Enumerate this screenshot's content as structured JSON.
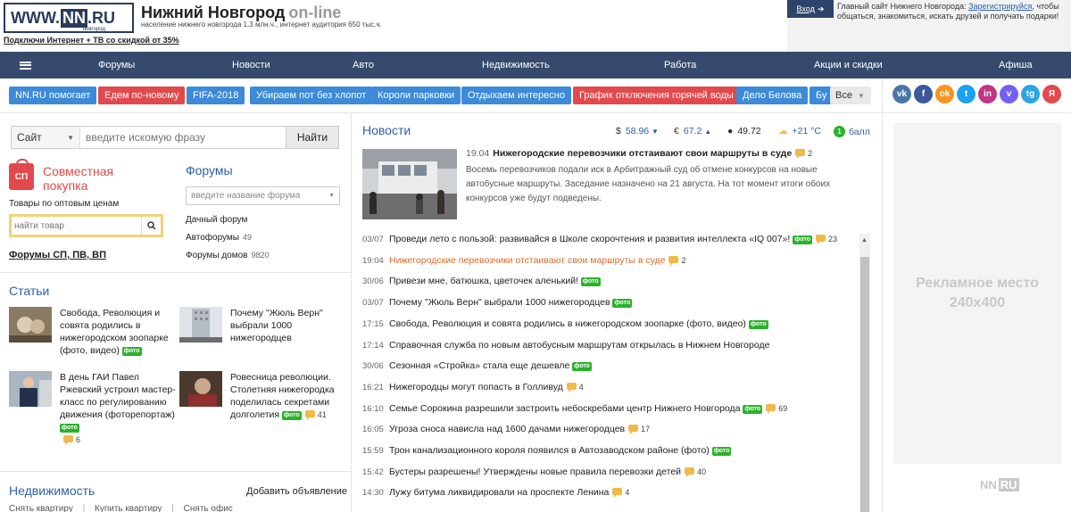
{
  "header": {
    "logo_main": "WWW.",
    "logo_nn": "NN",
    "logo_tld": ".RU",
    "logo_sub": "новгород",
    "title": "Нижний Новгород",
    "title_online": "on-line",
    "subtitle": "население нижнего новгорода 1.3 млн.ч., интернет аудитория 650 тыс.ч.",
    "promo": "Подключи Интернет + ТВ со скидкой от 35%",
    "login_label": "Вход",
    "auth_text_before": "Главный сайт Нижнего Новгорода:",
    "auth_register": "Зарегистрируйся",
    "auth_text_after": ", чтобы общаться, знакомиться, искать друзей и получать подарки!"
  },
  "nav": {
    "items": [
      "Форумы",
      "Новости",
      "Авто",
      "Недвижимость",
      "Работа",
      "Акции и скидки",
      "Афиша"
    ]
  },
  "tags": {
    "items": [
      {
        "label": "NN.RU помогает",
        "color": "blue"
      },
      {
        "label": "Едем по-новому",
        "color": "red"
      },
      {
        "label": "FIFA-2018",
        "color": "blue"
      },
      {
        "label": "Убираем пот без хлопот",
        "color": "blue"
      },
      {
        "label": "Короли парковки",
        "color": "blue"
      },
      {
        "label": "Отдыхаем интересно",
        "color": "blue"
      },
      {
        "label": "График отключения горячей воды",
        "color": "red"
      },
      {
        "label": "Дело Белова",
        "color": "blue"
      },
      {
        "label": "Бу",
        "color": "blue"
      }
    ],
    "more_label": "Все"
  },
  "social": [
    {
      "name": "vk-icon",
      "glyph": "vk",
      "color": "#4a76a8"
    },
    {
      "name": "facebook-icon",
      "glyph": "f",
      "color": "#3b5998"
    },
    {
      "name": "odnoklassniki-icon",
      "glyph": "ok",
      "color": "#f7931e"
    },
    {
      "name": "twitter-icon",
      "glyph": "t",
      "color": "#1da1f2"
    },
    {
      "name": "instagram-icon",
      "glyph": "in",
      "color": "#c13584"
    },
    {
      "name": "viber-icon",
      "glyph": "v",
      "color": "#7360f2"
    },
    {
      "name": "telegram-icon",
      "glyph": "tg",
      "color": "#2ca5e0"
    },
    {
      "name": "yandex-icon",
      "glyph": "Я",
      "color": "#e2494c"
    }
  ],
  "search": {
    "scope": "Сайт",
    "placeholder": "введите искомую фразу",
    "button": "Найти"
  },
  "sp": {
    "logo": "СП",
    "title": "Совместная покупка",
    "subtitle": "Товары по оптовым ценам",
    "placeholder": "найти товар",
    "forums_link": "Форумы СП, ПВ, ВП"
  },
  "forums": {
    "title": "Форумы",
    "placeholder": "введите название форума",
    "links": [
      {
        "label": "Дачный форум",
        "count": ""
      },
      {
        "label": "Автофорумы",
        "count": "49"
      },
      {
        "label": "Форумы домов",
        "count": "9820"
      }
    ]
  },
  "articles": {
    "title": "Статьи",
    "items": [
      {
        "text": "Свобода, Революция и совята родились в нижегородском зоопарке (фото, видео)",
        "badge": "фото",
        "comments": ""
      },
      {
        "text": "Почему \"Жюль Верн\" выбрали 1000 нижегородцев",
        "badge": "",
        "comments": ""
      },
      {
        "text": "В день ГАИ Павел Ржевский устроил мастер-класс по регулированию движения (фоторепортаж)",
        "badge": "фото",
        "comments": "6"
      },
      {
        "text": "Ровесница революции. Столетняя нижегородка поделилась секретами долголетия",
        "badge": "фото",
        "comments": "41"
      }
    ]
  },
  "realty": {
    "title": "Недвижимость",
    "add_label": "Добавить объявление",
    "links": [
      "Снять квартиру",
      "Купить квартиру",
      "Снять офис"
    ]
  },
  "news": {
    "title": "Новости",
    "usd_symbol": "$",
    "usd": "58.96",
    "eur_symbol": "€",
    "eur": "67.2",
    "oil": "49.72",
    "weather": "+21 °С",
    "ball_num": "1",
    "ball_label": "балл",
    "top": {
      "time": "19:04",
      "title": "Нижегородские перевозчики отстаивают свои маршруты в суде",
      "comments": "2",
      "desc": "Восемь перевозчиков подали иск в Арбитражный суд об отмене конкурсов на новые автобусные маршруты. Заседание назначено на 21 августа. На тот момент итоги обоих конкурсов уже будут подведены."
    },
    "items": [
      {
        "time": "03/07",
        "title": "Проведи лето с пользой: развивайся в Школе скорочтения и развития интеллекта «IQ 007»!",
        "badge": "фото",
        "comments": "23",
        "hl": false
      },
      {
        "time": "19:04",
        "title": "Нижегородские перевозчики отстаивают свои маршруты в суде",
        "badge": "",
        "comments": "2",
        "hl": true
      },
      {
        "time": "30/06",
        "title": "Привези мне, батюшка, цветочек аленький!",
        "badge": "фото",
        "comments": "",
        "hl": false
      },
      {
        "time": "03/07",
        "title": "Почему \"Жюль Верн\" выбрали 1000 нижегородцев",
        "badge": "фото",
        "comments": "",
        "hl": false
      },
      {
        "time": "17:15",
        "title": "Свобода, Революция и совята родились в нижегородском зоопарке (фото, видео)",
        "badge": "фото",
        "comments": "",
        "hl": false
      },
      {
        "time": "17:14",
        "title": "Справочная служба по новым автобусным маршрутам открылась в Нижнем Новгороде",
        "badge": "",
        "comments": "",
        "hl": false
      },
      {
        "time": "30/06",
        "title": "Сезонная «Стройка» стала еще дешевле",
        "badge": "фото",
        "comments": "",
        "hl": false
      },
      {
        "time": "16:21",
        "title": "Нижегородцы могут попасть в Голливуд",
        "badge": "",
        "comments": "4",
        "hl": false
      },
      {
        "time": "16:10",
        "title": "Семье Сорокина разрешили застроить небоскребами центр Нижнего Новгорода",
        "badge": "фото",
        "comments": "69",
        "hl": false
      },
      {
        "time": "16:05",
        "title": "Угроза сноса нависла над 1600 дачами нижегородцев",
        "badge": "",
        "comments": "17",
        "hl": false
      },
      {
        "time": "15:59",
        "title": "Трон канализационного короля появился в Автозаводском районе (фото)",
        "badge": "фото",
        "comments": "",
        "hl": false
      },
      {
        "time": "15:42",
        "title": "Бустеры разрешены! Утверждены новые правила перевозки детей",
        "badge": "",
        "comments": "40",
        "hl": false
      },
      {
        "time": "14:30",
        "title": "Лужу битума ликвидировали на проспекте Ленина",
        "badge": "",
        "comments": "4",
        "hl": false
      }
    ]
  },
  "ad": {
    "line1": "Рекламное место",
    "line2": "240x400"
  },
  "footer_logo": {
    "a": "NN",
    "b": "RU"
  }
}
